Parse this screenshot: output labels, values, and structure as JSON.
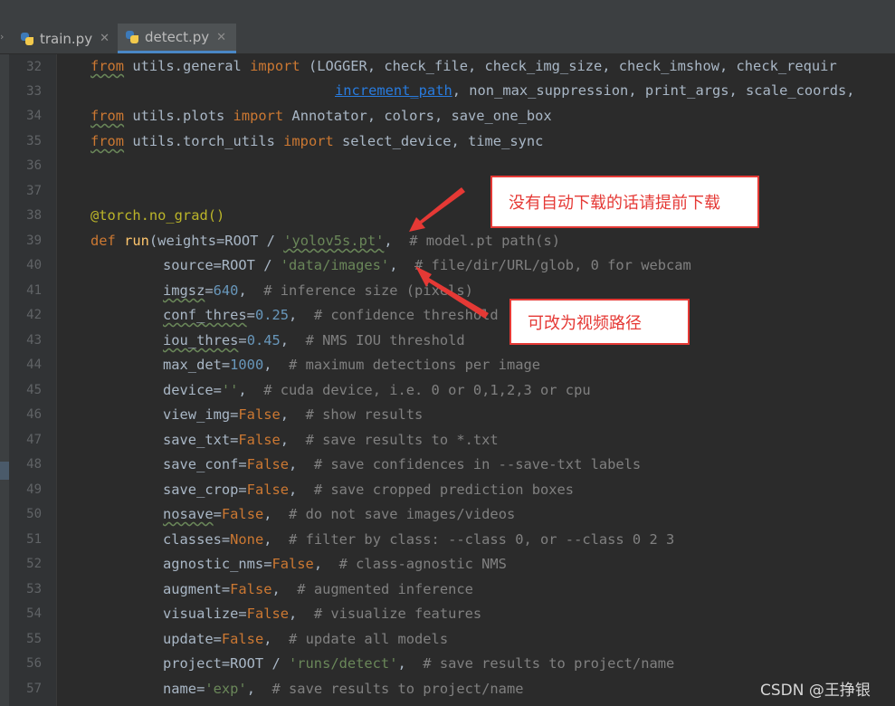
{
  "tabs": [
    {
      "label": "train.py",
      "active": false
    },
    {
      "label": "detect.py",
      "active": true
    }
  ],
  "line_numbers": [
    "32",
    "33",
    "34",
    "35",
    "36",
    "37",
    "38",
    "39",
    "40",
    "41",
    "42",
    "43",
    "44",
    "45",
    "46",
    "47",
    "48",
    "49",
    "50",
    "51",
    "52",
    "53",
    "54",
    "55",
    "56",
    "57"
  ],
  "code": {
    "l32": {
      "t1": "from",
      "t2": " utils.general ",
      "t3": "import",
      "t4": " (LOGGER, check_file, check_img_size, check_imshow, check_requir"
    },
    "l33": {
      "t1": "increment_path",
      "t2": ", non_max_suppression, print_args, scale_coords,"
    },
    "l34": {
      "t1": "from",
      "t2": " utils.plots ",
      "t3": "import",
      "t4": " Annotator, colors, save_one_box"
    },
    "l35": {
      "t1": "from",
      "t2": " utils.torch_utils ",
      "t3": "import",
      "t4": " select_device, time_sync"
    },
    "l38": {
      "t1": "@torch.no_grad()"
    },
    "l39": {
      "t1": "def",
      "t2": " ",
      "t3": "run",
      "t4": "(weights=ROOT / ",
      "t5": "'yolov5s.pt'",
      "t6": ",  ",
      "t7": "# model.pt path(s)"
    },
    "l40": {
      "t1": "source=ROOT / ",
      "t2": "'data/images'",
      "t3": ",  ",
      "t4": "# file/dir/URL/glob, 0 for webcam"
    },
    "l41": {
      "t1": "imgsz",
      "t2": "=",
      "t3": "640",
      "t4": ",  ",
      "t5": "# inference size (pixels)"
    },
    "l42": {
      "t1": "conf_thres",
      "t2": "=",
      "t3": "0.25",
      "t4": ",  ",
      "t5": "# confidence threshold"
    },
    "l43": {
      "t1": "iou_thres",
      "t2": "=",
      "t3": "0.45",
      "t4": ",  ",
      "t5": "# NMS IOU threshold"
    },
    "l44": {
      "t1": "max_det=",
      "t2": "1000",
      "t3": ",  ",
      "t4": "# maximum detections per image"
    },
    "l45": {
      "t1": "device=",
      "t2": "''",
      "t3": ",  ",
      "t4": "# cuda device, i.e. 0 or 0,1,2,3 or cpu"
    },
    "l46": {
      "t1": "view_img=",
      "t2": "False",
      "t3": ",  ",
      "t4": "# show results"
    },
    "l47": {
      "t1": "save_txt=",
      "t2": "False",
      "t3": ",  ",
      "t4": "# save results to *.txt"
    },
    "l48": {
      "t1": "save_conf=",
      "t2": "False",
      "t3": ",  ",
      "t4": "# save confidences in --save-txt labels"
    },
    "l49": {
      "t1": "save_crop=",
      "t2": "False",
      "t3": ",  ",
      "t4": "# save cropped prediction boxes"
    },
    "l50": {
      "t1": "nosave",
      "t2": "=",
      "t3": "False",
      "t4": ",  ",
      "t5": "# do not save images/videos"
    },
    "l51": {
      "t1": "classes=",
      "t2": "None",
      "t3": ",  ",
      "t4": "# filter by class: --class 0, or --class 0 2 3"
    },
    "l52": {
      "t1": "agnostic_nms=",
      "t2": "False",
      "t3": ",  ",
      "t4": "# class-agnostic NMS"
    },
    "l53": {
      "t1": "augment=",
      "t2": "False",
      "t3": ",  ",
      "t4": "# augmented inference"
    },
    "l54": {
      "t1": "visualize=",
      "t2": "False",
      "t3": ",  ",
      "t4": "# visualize features"
    },
    "l55": {
      "t1": "update=",
      "t2": "False",
      "t3": ",  ",
      "t4": "# update all models"
    },
    "l56": {
      "t1": "project=ROOT / ",
      "t2": "'runs/detect'",
      "t3": ",  ",
      "t4": "# save results to project/name"
    },
    "l57": {
      "t1": "name=",
      "t2": "'exp'",
      "t3": ",  ",
      "t4": "# save results to project/name"
    }
  },
  "annotations": {
    "download_note": "没有自动下载的话请提前下载",
    "video_note": "可改为视频路径"
  },
  "watermark": "CSDN @王挣银",
  "colors": {
    "keyword": "#cc7832",
    "string": "#6a8759",
    "number": "#6897bb",
    "comment": "#808080",
    "function": "#ffc66d",
    "decorator": "#bbb529",
    "annotation_red": "#e53935"
  },
  "icons": [
    "python-file-icon",
    "close-icon"
  ]
}
